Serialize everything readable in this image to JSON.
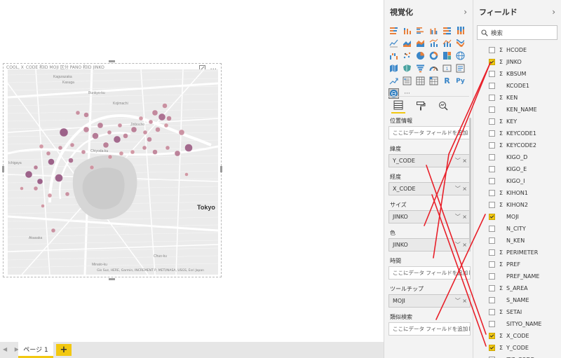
{
  "visual": {
    "header_text": "COOL, X_CODE 和ID MOJI 区分 PANO 和ID JINKO",
    "map_labels": [
      "Kagurazaka",
      "Kasuga",
      "Bunkyo-ku",
      "Chiyoda-ku",
      "Tokyo",
      "Ichigaya",
      "Akasaka",
      "Chuo-ku",
      "Minato-ku",
      "Kojimachi",
      "Jinbocho"
    ],
    "attribution": "Gis Suz, HERE, Garmin, INCREMENT P, METI/NASA, USGS, Esri Japan",
    "more_label": "···"
  },
  "pagebar": {
    "nav": "◀ ▶",
    "page_tab": "ページ 1",
    "add_label": "+"
  },
  "viz_pane": {
    "title": "視覚化",
    "chevron": "›",
    "r_label": "R",
    "py_label": "Py",
    "more_label": "···",
    "wells": [
      {
        "label": "位置情報",
        "value": "ここにデータ フィールドを追加して...",
        "filled": false
      },
      {
        "label": "緯度",
        "value": "Y_CODE",
        "filled": true
      },
      {
        "label": "経度",
        "value": "X_CODE",
        "filled": true
      },
      {
        "label": "サイズ",
        "value": "JINKO",
        "filled": true
      },
      {
        "label": "色",
        "value": "JINKO",
        "filled": true
      },
      {
        "label": "時間",
        "value": "ここにデータ フィールドを追加して...",
        "filled": false
      },
      {
        "label": "ツールチップ",
        "value": "MOJI",
        "filled": true
      },
      {
        "label": "類似検索",
        "value": "ここにデータ フィールドを追加して...",
        "filled": false
      }
    ],
    "field_actions": "﹀ ×"
  },
  "fields_pane": {
    "title": "フィールド",
    "chevron": "›",
    "search_placeholder": "検索",
    "fields": [
      {
        "name": "HCODE",
        "sigma": true,
        "checked": false
      },
      {
        "name": "JINKO",
        "sigma": true,
        "checked": true
      },
      {
        "name": "KBSUM",
        "sigma": true,
        "checked": false
      },
      {
        "name": "KCODE1",
        "sigma": false,
        "checked": false
      },
      {
        "name": "KEN",
        "sigma": true,
        "checked": false
      },
      {
        "name": "KEN_NAME",
        "sigma": false,
        "checked": false
      },
      {
        "name": "KEY",
        "sigma": true,
        "checked": false
      },
      {
        "name": "KEYCODE1",
        "sigma": true,
        "checked": false
      },
      {
        "name": "KEYCODE2",
        "sigma": true,
        "checked": false
      },
      {
        "name": "KIGO_D",
        "sigma": false,
        "checked": false
      },
      {
        "name": "KIGO_E",
        "sigma": false,
        "checked": false
      },
      {
        "name": "KIGO_I",
        "sigma": false,
        "checked": false
      },
      {
        "name": "KIHON1",
        "sigma": true,
        "checked": false
      },
      {
        "name": "KIHON2",
        "sigma": true,
        "checked": false
      },
      {
        "name": "MOJI",
        "sigma": false,
        "checked": true
      },
      {
        "name": "N_CITY",
        "sigma": false,
        "checked": false
      },
      {
        "name": "N_KEN",
        "sigma": false,
        "checked": false
      },
      {
        "name": "PERIMETER",
        "sigma": true,
        "checked": false
      },
      {
        "name": "PREF",
        "sigma": true,
        "checked": false
      },
      {
        "name": "PREF_NAME",
        "sigma": false,
        "checked": false
      },
      {
        "name": "S_AREA",
        "sigma": true,
        "checked": false
      },
      {
        "name": "S_NAME",
        "sigma": false,
        "checked": false
      },
      {
        "name": "SETAI",
        "sigma": true,
        "checked": false
      },
      {
        "name": "SITYO_NAME",
        "sigma": false,
        "checked": false
      },
      {
        "name": "X_CODE",
        "sigma": true,
        "checked": true
      },
      {
        "name": "Y_CODE",
        "sigma": true,
        "checked": true
      },
      {
        "name": "ZIP_CODE",
        "sigma": false,
        "checked": false
      }
    ]
  },
  "colors": {
    "accent": "#f2c811",
    "bubble_dark": "#8e4a78",
    "bubble_light": "#e7a6a6",
    "annotation": "#e8202a"
  }
}
